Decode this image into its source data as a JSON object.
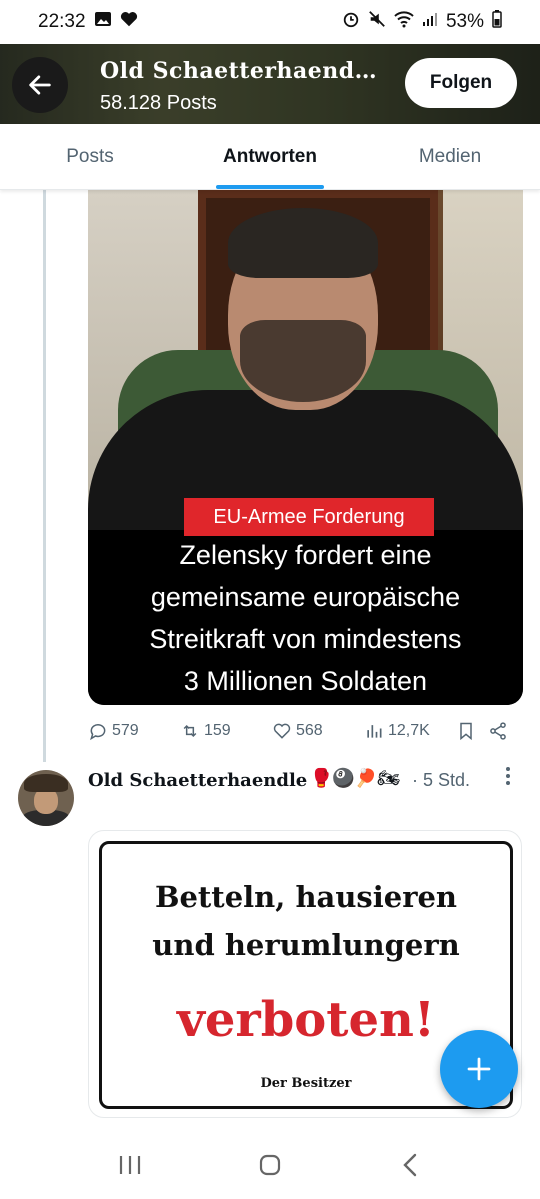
{
  "status_bar": {
    "time": "22:32",
    "battery": "53%",
    "icons_left": [
      "image-icon",
      "heart-icon"
    ],
    "icons_right": [
      "alarm-icon",
      "mute-icon",
      "wifi-icon",
      "signal-icon",
      "battery-icon"
    ]
  },
  "header": {
    "name": "Old Schaetterhaend…",
    "posts": "58.128 Posts",
    "follow_label": "Folgen"
  },
  "tabs": [
    {
      "label": "Posts",
      "active": false
    },
    {
      "label": "Antworten",
      "active": true
    },
    {
      "label": "Medien",
      "active": false
    }
  ],
  "post1": {
    "media_tag": "EU-Armee Forderung",
    "media_caption_1": "Zelensky fordert eine",
    "media_caption_2": "gemeinsame europäische",
    "media_caption_3": "Streitkraft von mindestens",
    "media_caption_4": "3 Millionen Soldaten",
    "replies": "579",
    "reposts": "159",
    "likes": "568",
    "views": "12,7K"
  },
  "post2": {
    "name": "Old Schaetterhaendle",
    "emojis": "🥊🎱🏓🏍",
    "time": "· 5 Std.",
    "sign_line1": "Betteln, hausieren",
    "sign_line2": "und herumlungern",
    "sign_line3": "verboten!",
    "sign_line4": "Der Besitzer"
  },
  "colors": {
    "accent": "#1d9bf0",
    "sign_red": "#d6262e",
    "tag_red": "#e0262b"
  }
}
